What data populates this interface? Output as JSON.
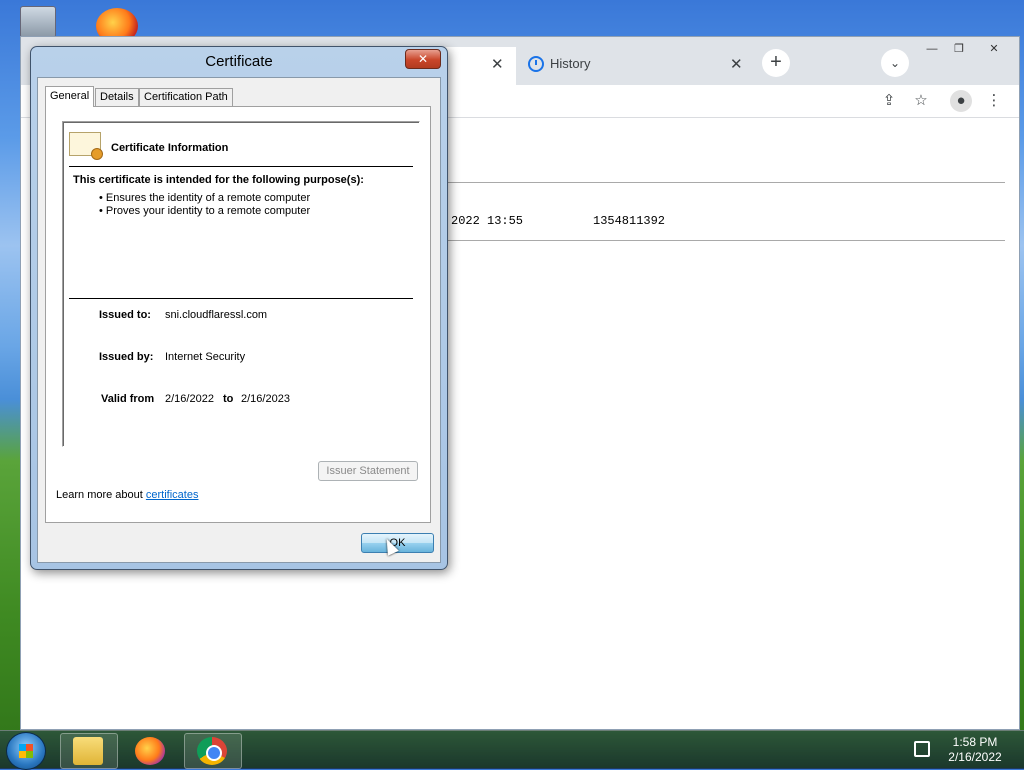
{
  "browser": {
    "history_tab_label": "History",
    "active_tab_close": "✕",
    "history_tab_close": "✕",
    "new_tab": "+",
    "tab_search": "⌄",
    "window_controls": [
      "—",
      "❐",
      "✕"
    ],
    "toolbar_icons": [
      "share-icon",
      "bookmark-star-icon",
      "profile-icon",
      "menu-icon"
    ],
    "page": {
      "row_time": "2022 13:55",
      "row_value": "1354811392"
    }
  },
  "dialog": {
    "title": "Certificate",
    "close": "✕",
    "tabs": [
      "General",
      "Details",
      "Certification Path"
    ],
    "info_heading": "Certificate Information",
    "purpose_heading": "This certificate is intended for the following purpose(s):",
    "purposes": [
      "Ensures the identity of a remote computer",
      "Proves your identity to a remote computer"
    ],
    "issued_to_label": "Issued to:",
    "issued_to_value": "sni.cloudflaressl.com",
    "issued_by_label": "Issued by:",
    "issued_by_value": "Internet Security",
    "valid_from_label": "Valid from",
    "valid_from_value": "2/16/2022",
    "to_label": "to",
    "valid_to_value": "2/16/2023",
    "issuer_statement_button": "Issuer Statement",
    "learn_more_text": "Learn more about",
    "learn_more_link": "certificates",
    "ok_button": "OK"
  },
  "taskbar": {
    "clock_time": "1:58 PM",
    "clock_date": "2/16/2022",
    "apps": [
      "file-explorer-icon",
      "firefox-icon",
      "chrome-icon"
    ]
  }
}
